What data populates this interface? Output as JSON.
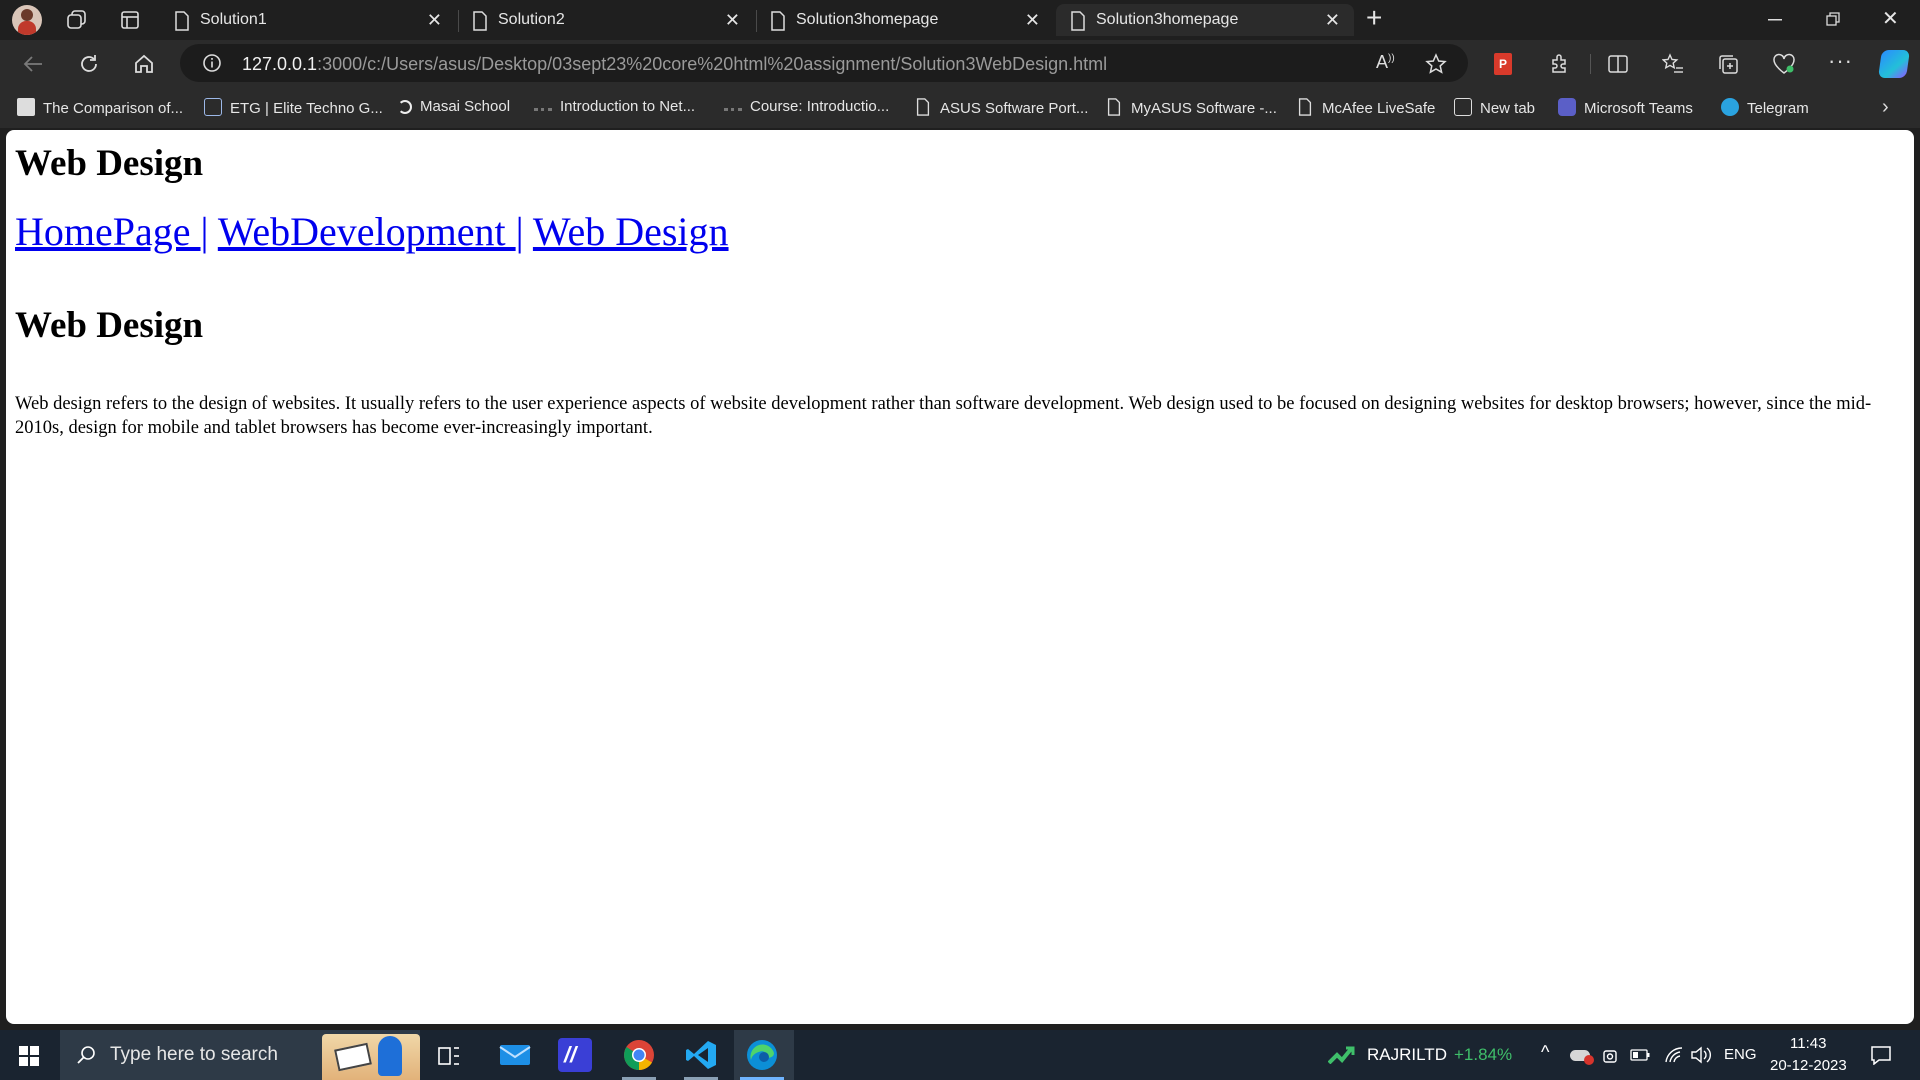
{
  "browser": {
    "tabs": [
      {
        "title": "Solution1"
      },
      {
        "title": "Solution2"
      },
      {
        "title": "Solution3homepage"
      },
      {
        "title": "Solution3homepage"
      }
    ],
    "address": {
      "host": "127.0.0.1",
      "path": ":3000/c:/Users/asus/Desktop/03sept23%20core%20html%20assignment/Solution3WebDesign.html"
    },
    "bookmarks": [
      {
        "label": "The Comparison of..."
      },
      {
        "label": "ETG | Elite Techno G..."
      },
      {
        "label": "Masai School"
      },
      {
        "label": "Introduction to Net..."
      },
      {
        "label": "Course: Introductio..."
      },
      {
        "label": "ASUS Software Port..."
      },
      {
        "label": "MyASUS Software -..."
      },
      {
        "label": "McAfee LiveSafe"
      },
      {
        "label": "New tab"
      },
      {
        "label": "Microsoft Teams"
      },
      {
        "label": "Telegram"
      }
    ],
    "extension_badge": "P"
  },
  "page": {
    "heading": "Web Design",
    "nav": {
      "home": "HomePage ",
      "sep1": "|",
      "webdev": "WebDevelopment ",
      "sep2": "|",
      "webdesign": "Web Design"
    },
    "subheading": "Web Design",
    "paragraph": "Web design refers to the design of websites. It usually refers to the user experience aspects of website development rather than software development. Web design used to be focused on designing websites for desktop browsers; however, since the mid-2010s, design for mobile and tablet browsers has become ever-increasingly important."
  },
  "taskbar": {
    "search_placeholder": "Type here to search",
    "stock_name": "RAJRILTD",
    "stock_change": "+1.84%",
    "language": "ENG",
    "time": "11:43",
    "date": "20-12-2023"
  },
  "colors": {
    "link": "#0000ee",
    "stock_up": "#3fbf6a",
    "edge_accent": "#0078d4"
  }
}
